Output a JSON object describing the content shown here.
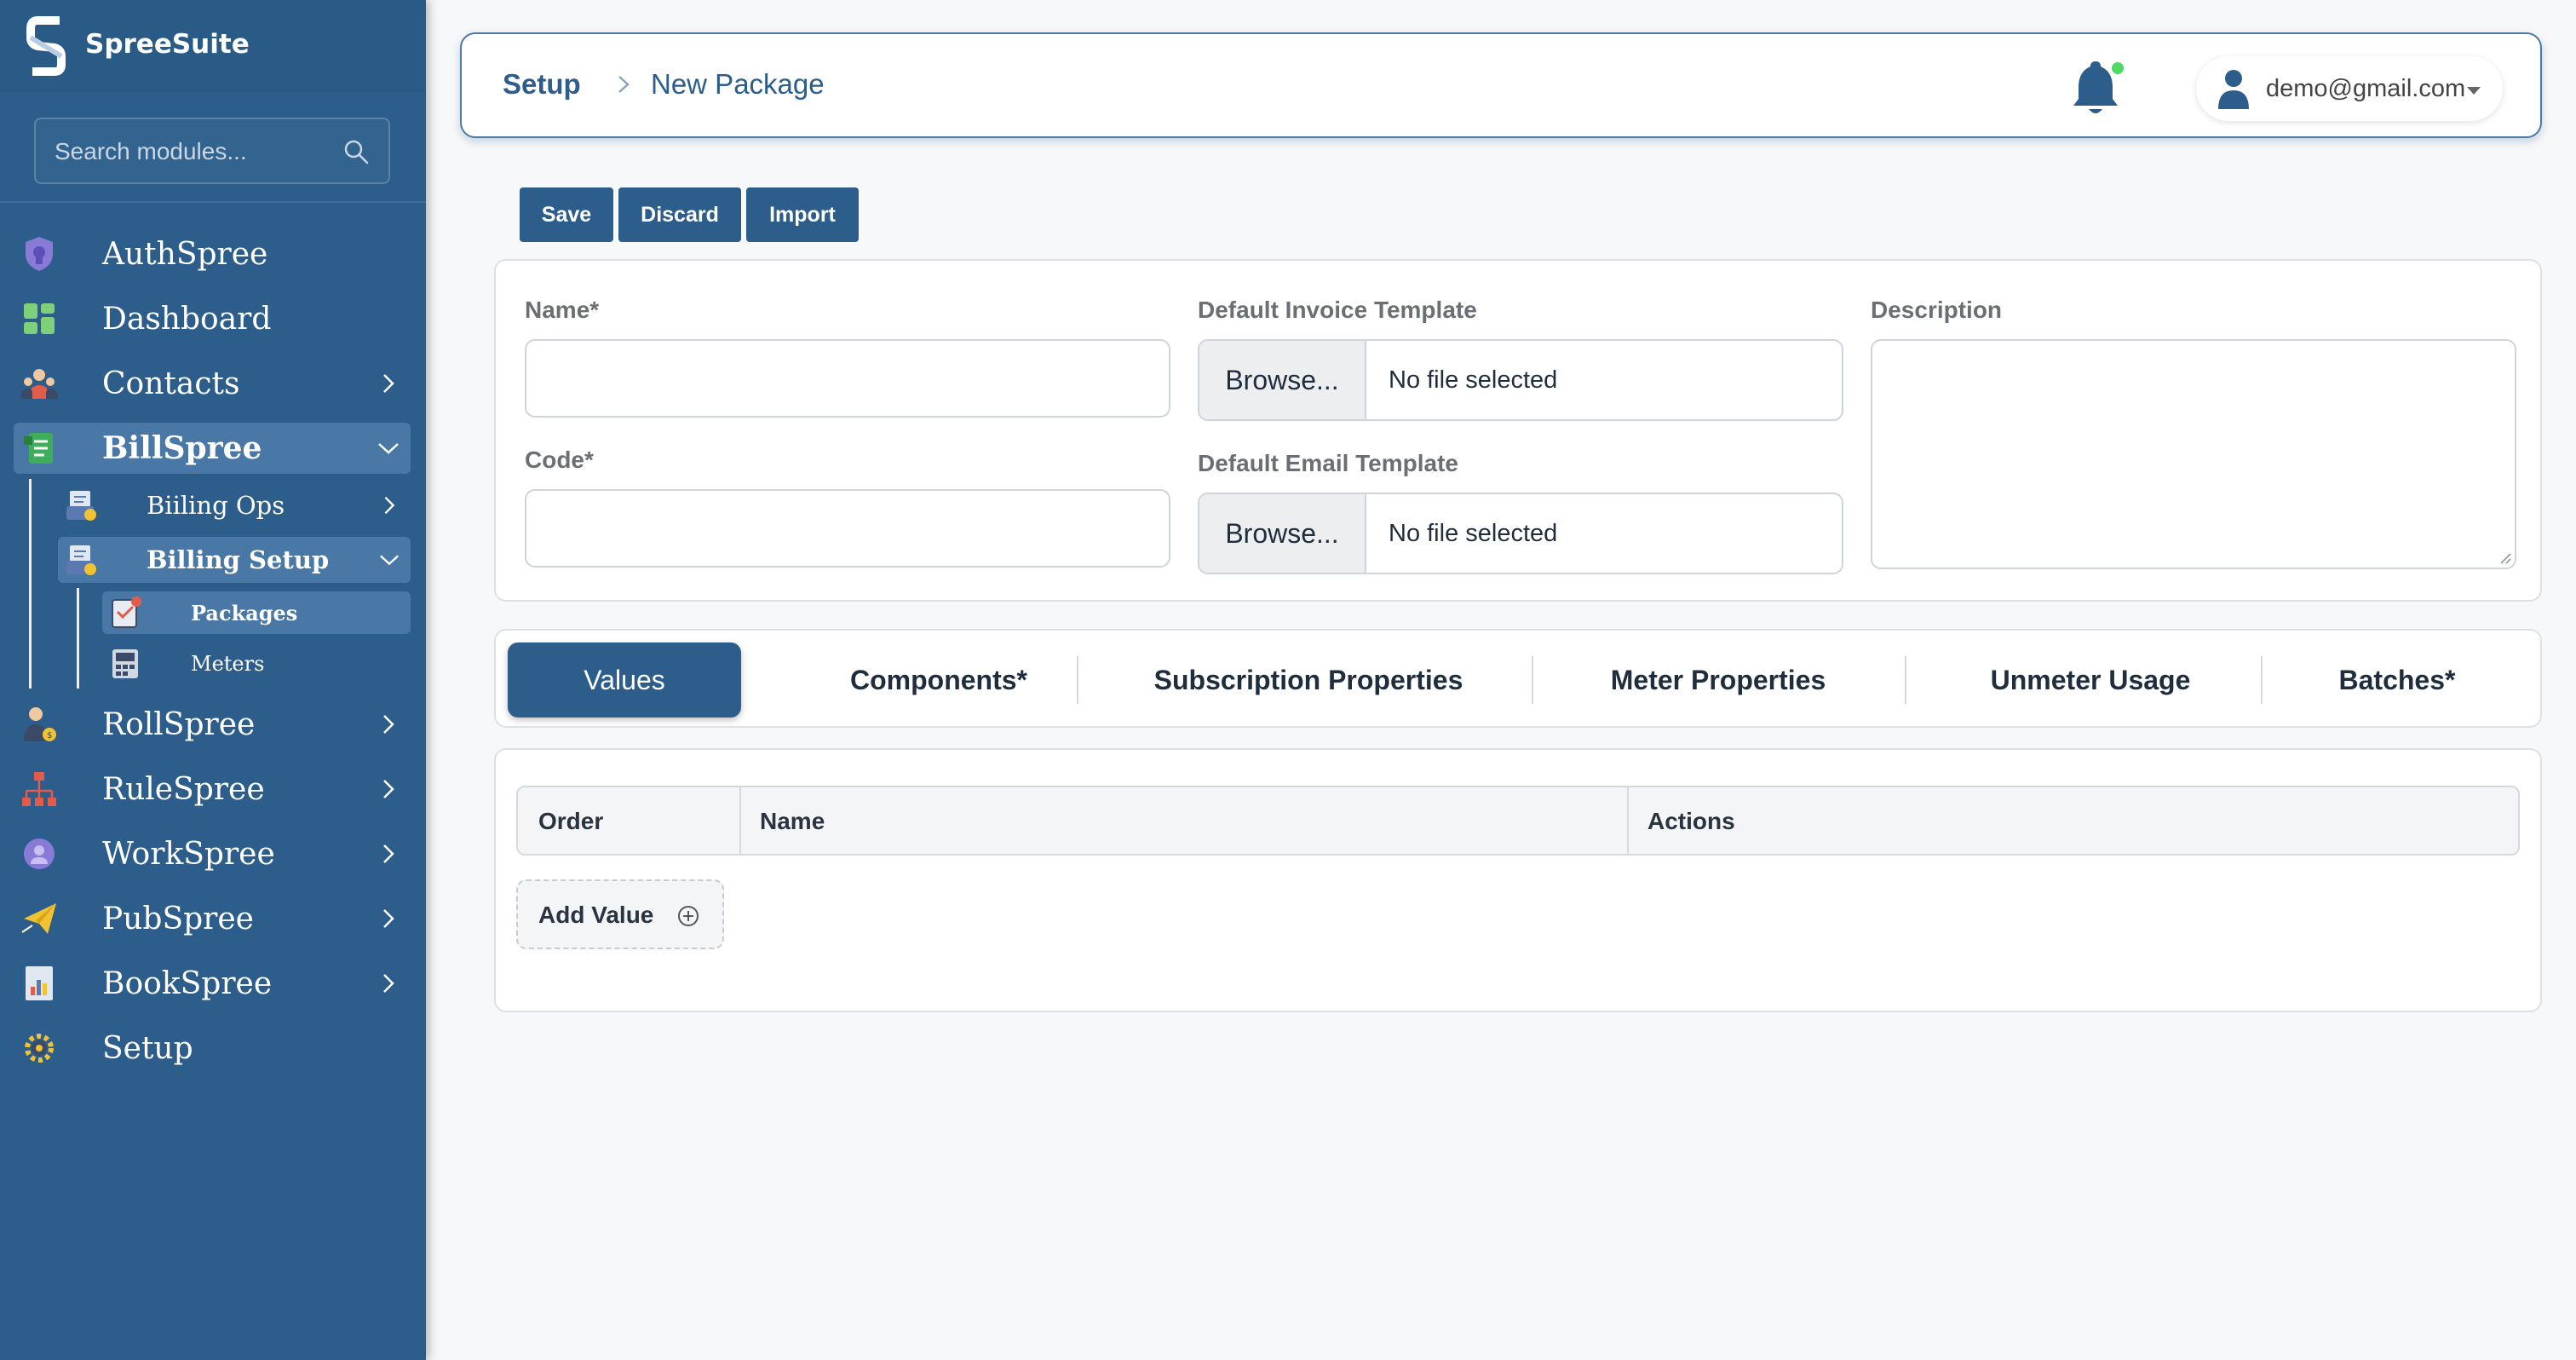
{
  "brand": {
    "name": "SpreeSuite"
  },
  "search": {
    "placeholder": "Search modules..."
  },
  "sidebar": {
    "items": [
      {
        "label": "AuthSpree"
      },
      {
        "label": "Dashboard"
      },
      {
        "label": "Contacts"
      },
      {
        "label": "BillSpree"
      },
      {
        "label": "RollSpree"
      },
      {
        "label": "RuleSpree"
      },
      {
        "label": "WorkSpree"
      },
      {
        "label": "PubSpree"
      },
      {
        "label": "BookSpree"
      },
      {
        "label": "Setup"
      }
    ],
    "billspree_children": [
      {
        "label": "Biiling Ops"
      },
      {
        "label": "Billing Setup"
      }
    ],
    "billing_setup_children": [
      {
        "label": "Packages"
      },
      {
        "label": "Meters"
      }
    ]
  },
  "header": {
    "breadcrumb_root": "Setup",
    "breadcrumb_current": "New Package",
    "user_email": "demo@gmail.com"
  },
  "toolbar": {
    "save": "Save",
    "discard": "Discard",
    "import": "Import"
  },
  "form": {
    "name_label": "Name*",
    "name_value": "",
    "code_label": "Code*",
    "code_value": "",
    "invoice_template_label": "Default Invoice Template",
    "email_template_label": "Default Email Template",
    "browse_label": "Browse...",
    "no_file": "No file selected",
    "description_label": "Description"
  },
  "tabs": [
    {
      "label": "Values",
      "active": true
    },
    {
      "label": "Components*"
    },
    {
      "label": "Subscription Properties"
    },
    {
      "label": "Meter Properties"
    },
    {
      "label": "Unmeter Usage"
    },
    {
      "label": "Batches*"
    }
  ],
  "table": {
    "columns": [
      "Order",
      "Name",
      "Actions"
    ],
    "add_label": "Add Value"
  },
  "colors": {
    "primary": "#2c5d8b",
    "sidebar": "#2c5d8b",
    "notification_dot": "#4cd964"
  }
}
